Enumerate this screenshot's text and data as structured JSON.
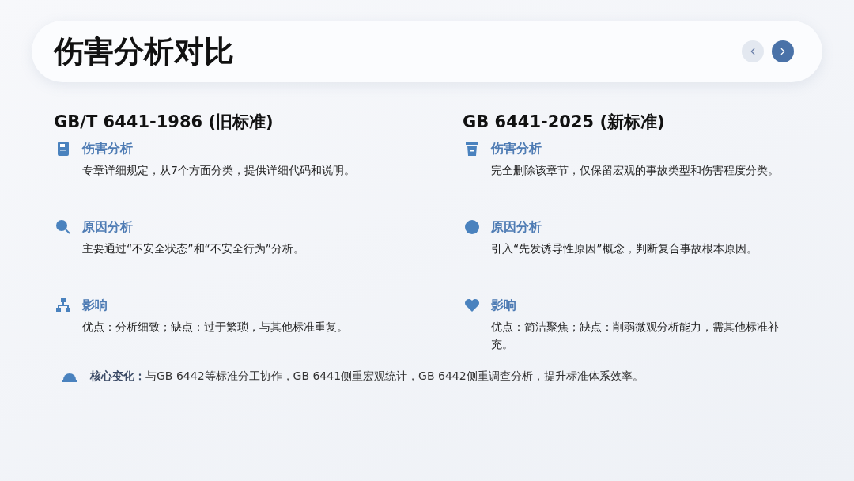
{
  "header": {
    "title": "伤害分析对比",
    "nav": [
      {
        "kind": "prev",
        "disabled": true
      },
      {
        "kind": "next",
        "disabled": false
      }
    ]
  },
  "columns": [
    {
      "heading": "GB/T 6441-1986 (旧标准)",
      "items": [
        {
          "label": "伤害分析",
          "text": "专章详细规定，从7个方面分类，提供详细代码和说明。"
        },
        {
          "label": "原因分析",
          "text": "主要通过“不安全状态”和“不安全行为”分析。"
        },
        {
          "label": "影响",
          "text": "优点：分析细致；缺点：过于繁琐，与其他标准重复。"
        }
      ]
    },
    {
      "heading": "GB 6441-2025 (新标准)",
      "items": [
        {
          "label": "伤害分析",
          "text": "完全删除该章节，仅保留宏观的事故类型和伤害程度分类。"
        },
        {
          "label": "原因分析",
          "text": "引入“先发诱导性原因”概念，判断复合事故根本原因。"
        },
        {
          "label": "影响",
          "text": "优点：简洁聚焦；缺点：削弱微观分析能力，需其他标准补充。"
        }
      ]
    }
  ],
  "summary": "**核心变化：**与GB 6442等标准分工协作，GB 6441侧重宏观统计，GB 6442侧重调查分析，提升标准体系效率。"
}
